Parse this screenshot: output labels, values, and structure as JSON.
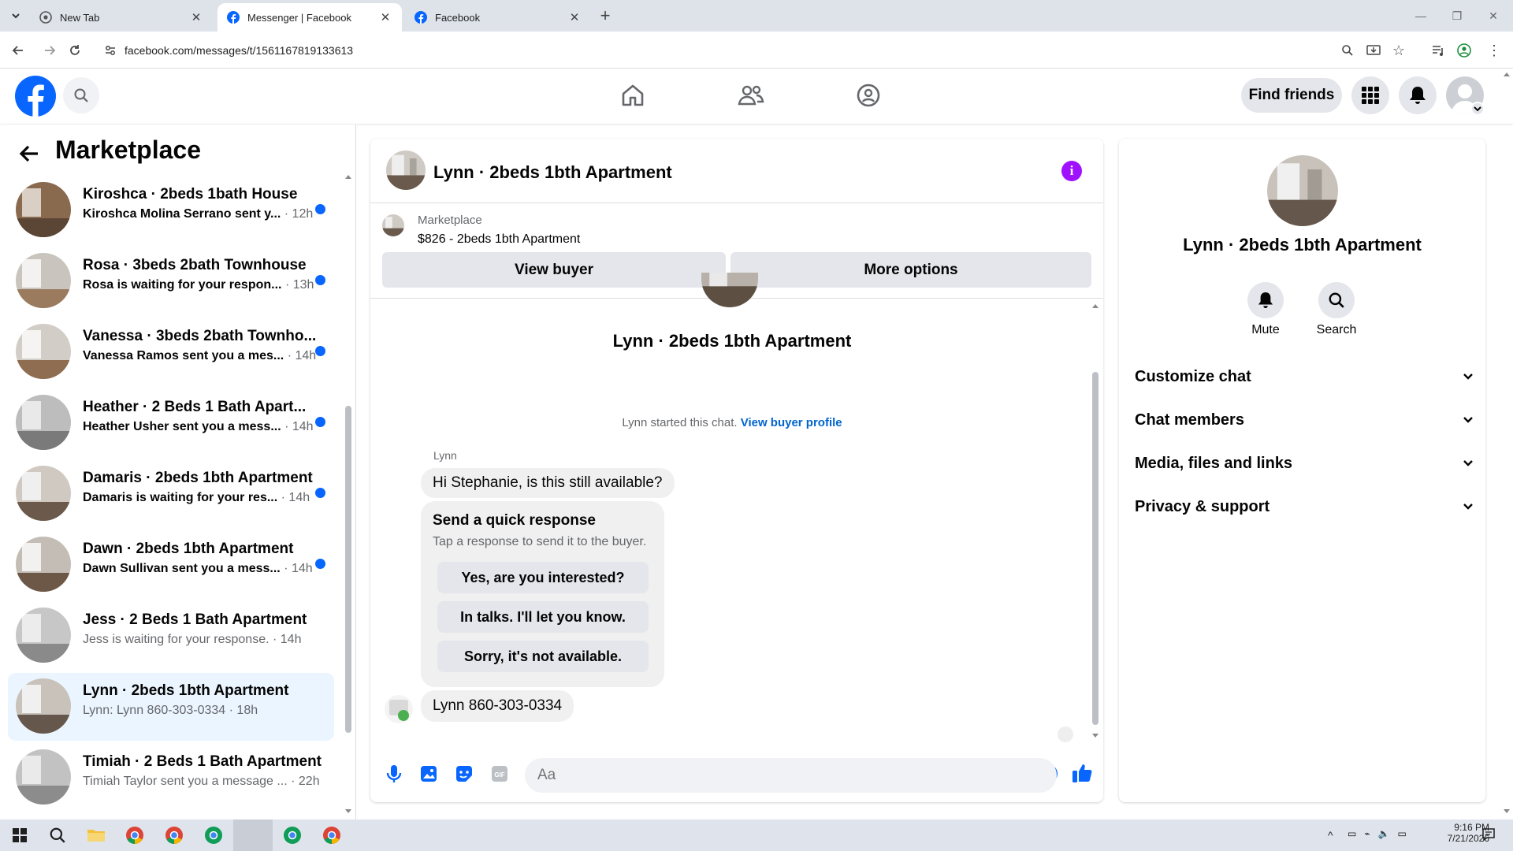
{
  "browser": {
    "tabs": [
      {
        "title": "New Tab",
        "favicon": "chrome-icon"
      },
      {
        "title": "Messenger | Facebook",
        "favicon": "facebook-icon"
      },
      {
        "title": "Facebook",
        "favicon": "facebook-icon"
      }
    ],
    "url": "facebook.com/messages/t/1561167819133613"
  },
  "fb_header": {
    "find_friends": "Find friends"
  },
  "sidebar": {
    "title": "Marketplace",
    "conversations": [
      {
        "name": "Kiroshca · 2beds 1bath House",
        "preview": "Kiroshca Molina Serrano sent y...",
        "time": "· 12h",
        "unread": true
      },
      {
        "name": "Rosa · 3beds 2bath Townhouse",
        "preview": "Rosa is waiting for your respon...",
        "time": "· 13h",
        "unread": true
      },
      {
        "name": "Vanessa · 3beds 2bath Townho...",
        "preview": "Vanessa Ramos sent you a mes...",
        "time": "· 14h",
        "unread": true
      },
      {
        "name": "Heather · 2 Beds 1 Bath Apart...",
        "preview": "Heather Usher sent you a mess...",
        "time": "· 14h",
        "unread": true
      },
      {
        "name": "Damaris · 2beds 1bth Apartment",
        "preview": "Damaris is waiting for your res...",
        "time": "· 14h",
        "unread": true
      },
      {
        "name": "Dawn · 2beds 1bth Apartment",
        "preview": "Dawn Sullivan sent you a mess...",
        "time": "· 14h",
        "unread": true
      },
      {
        "name": "Jess · 2 Beds 1 Bath Apartment",
        "preview": "Jess is waiting for your response.",
        "time": "· 14h",
        "unread": false
      },
      {
        "name": "Lynn · 2beds 1bth Apartment",
        "preview": "Lynn: Lynn 860-303-0334",
        "time": "· 18h",
        "unread": false,
        "selected": true
      },
      {
        "name": "Timiah · 2 Beds 1 Bath Apartment",
        "preview": "Timiah Taylor sent you a message ...",
        "time": "· 22h",
        "unread": false
      }
    ]
  },
  "chat": {
    "title": "Lynn · 2beds 1bth Apartment",
    "marketplace_label": "Marketplace",
    "listing": "$826 - 2beds 1bth Apartment",
    "view_buyer": "View buyer",
    "more_options": "More options",
    "intro_name": "Lynn · 2beds 1bth Apartment",
    "started_text": "Lynn started this chat.",
    "view_buyer_profile": "View buyer profile",
    "sender": "Lynn",
    "message1": "Hi Stephanie, is this still available?",
    "quick_title": "Send a quick response",
    "quick_sub": "Tap a response to send it to the buyer.",
    "quick_replies": [
      "Yes, are you interested?",
      "In talks. I'll let you know.",
      "Sorry, it's not available."
    ],
    "message2": "Lynn 860-303-0334",
    "composer_placeholder": "Aa"
  },
  "details": {
    "name": "Lynn · 2beds 1bth Apartment",
    "mute": "Mute",
    "search": "Search",
    "sections": [
      "Customize chat",
      "Chat members",
      "Media, files and links",
      "Privacy & support"
    ]
  },
  "taskbar": {
    "time": "9:16 PM",
    "date": "7/21/2026"
  },
  "colors": {
    "fb_blue": "#0866ff",
    "info_purple": "#a011ff",
    "selected_row": "#ebf5ff"
  }
}
